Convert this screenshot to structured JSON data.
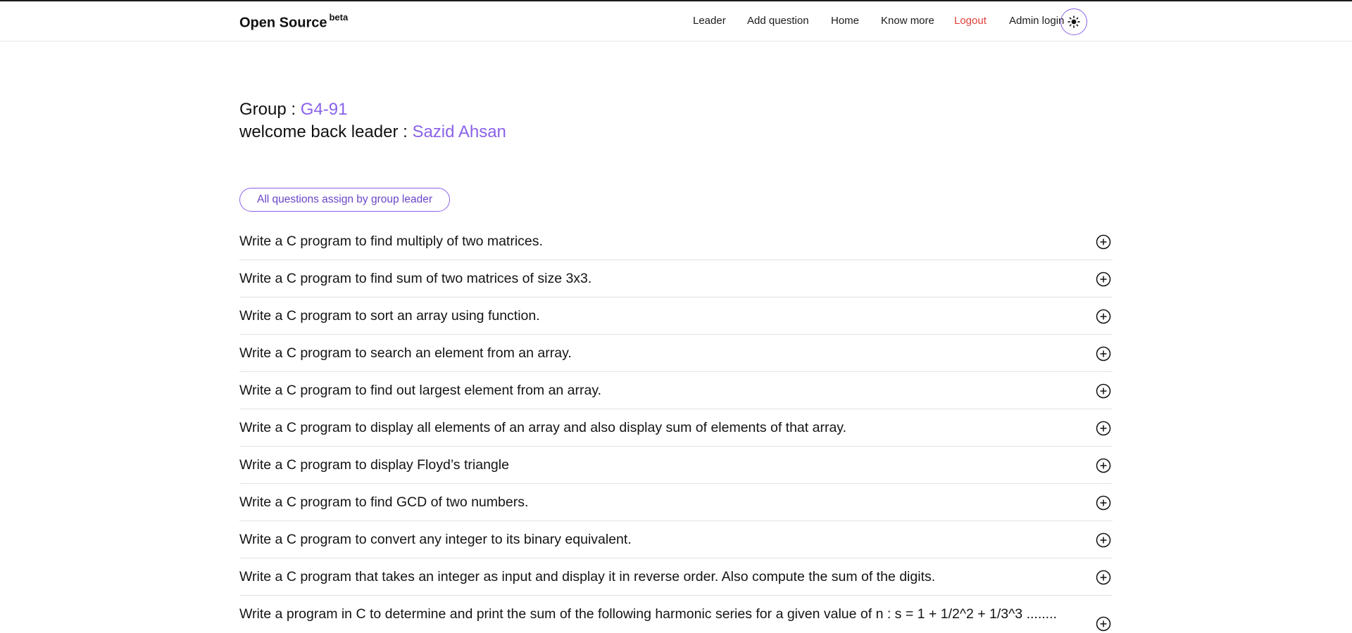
{
  "navbar": {
    "brand": "Open Source",
    "brand_badge": "beta",
    "links": [
      {
        "label": "Leader"
      },
      {
        "label": "Add question"
      },
      {
        "label": "Home"
      },
      {
        "label": "Know more"
      },
      {
        "label": "Logout"
      },
      {
        "label": "Admin login"
      }
    ],
    "theme_toggle_icon": "sun-icon"
  },
  "greeting": {
    "group_label": "Group : ",
    "group_value": "G4-91",
    "welcome_label": "welcome back leader : ",
    "leader_name": "Sazid Ahsan"
  },
  "questions_header": "All questions assign by group leader",
  "questions": [
    "Write a C program to find multiply of two matrices.",
    "Write a C program to find sum of two matrices of size 3x3.",
    "Write a C program to sort an array using function.",
    "Write a C program to search an element from an array.",
    "Write a C program to find out largest element from an array.",
    "Write a C program to display all elements of an array and also display sum of elements of that array.",
    "Write a C program to display Floyd’s triangle",
    "Write a C program to find GCD of two numbers.",
    "Write a C program to convert any integer to its binary equivalent.",
    "Write a C program that takes an integer as input and display it in reverse order. Also compute the sum of the digits.",
    "Write a program in C to determine and print the sum of the following harmonic series for a given value of n : s = 1 + 1/2^2 + 1/3^3 ........"
  ],
  "colors": {
    "accent": "#8a63e8",
    "logout": "#e0413a",
    "divider": "#e2e2e2"
  }
}
